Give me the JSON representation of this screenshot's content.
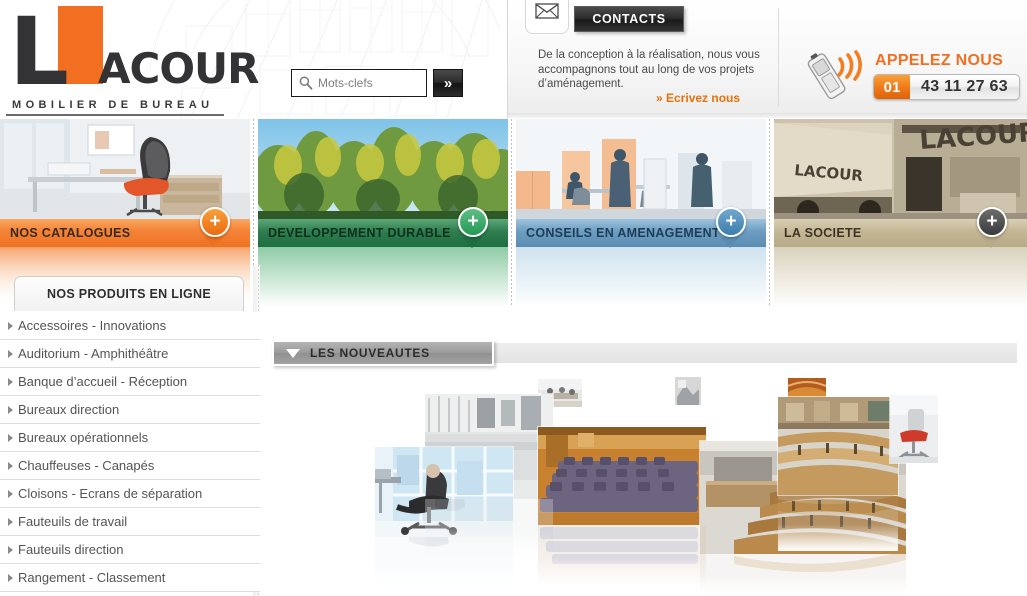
{
  "header": {
    "logo": {
      "letter": "L",
      "name": "ACOUR",
      "tagline": "MOBILIER DE BUREAU"
    },
    "search": {
      "placeholder": "Mots-clefs",
      "value": "",
      "button_label": "»",
      "icon": "search-icon"
    },
    "contacts": {
      "mail_icon": "envelope-icon",
      "button_label": "CONTACTS",
      "description": "De la conception à la réalisation, nous vous accompagnons tout au long de vos projets d’aménagement.",
      "link_label": "» Ecrivez nous"
    },
    "phone": {
      "icon": "mobile-phone-icon",
      "call_label": "APPELEZ NOUS",
      "prefix": "01",
      "number": "43 11 27 63"
    }
  },
  "banners": [
    {
      "label": "NOS CATALOGUES",
      "plus": "+",
      "accent": "#EE7120",
      "image": "office-desk-orange-chair"
    },
    {
      "label": "DEVELOPPEMENT DURABLE",
      "plus": "+",
      "accent": "#1E6E41",
      "image": "autumn-trees-sky"
    },
    {
      "label": "CONSEILS EN AMENAGEMENT",
      "plus": "+",
      "accent": "#5B8DB3",
      "image": "open-space-office-people"
    },
    {
      "label": "LA SOCIETE",
      "plus": "+",
      "accent": "#B7AA87",
      "image": "lacour-truck-warehouse-sepia"
    }
  ],
  "sidebar": {
    "tab_label": "NOS PRODUITS EN LIGNE",
    "items": [
      {
        "label": "Accessoires - Innovations"
      },
      {
        "label": "Auditorium - Amphithéâtre"
      },
      {
        "label": "Banque d’accueil - Réception"
      },
      {
        "label": "Bureaux direction"
      },
      {
        "label": "Bureaux opérationnels"
      },
      {
        "label": "Chauffeuses - Canapés"
      },
      {
        "label": "Cloisons - Ecrans de séparation"
      },
      {
        "label": "Fauteuils de travail"
      },
      {
        "label": "Fauteuils direction"
      },
      {
        "label": "Rangement - Classement"
      }
    ]
  },
  "main": {
    "nouveautes_label": "LES NOUVEAUTES",
    "nouveautes_icon": "triangle-down-icon",
    "collage": [
      {
        "name": "photo-conference-room-grey"
      },
      {
        "name": "photo-meeting-small"
      },
      {
        "name": "photo-auditorium-purple-seats"
      },
      {
        "name": "photo-lecture-hall-wood"
      },
      {
        "name": "photo-thumbnail-top"
      },
      {
        "name": "photo-executive-chair-window"
      },
      {
        "name": "photo-auditorium-orange-top"
      },
      {
        "name": "photo-curved-desks-hall"
      },
      {
        "name": "photo-red-chair-right"
      }
    ]
  },
  "colors": {
    "brand_orange": "#F26F21",
    "brand_dark": "#333335",
    "green": "#1E6E41",
    "blue": "#5B8DB3",
    "beige": "#B7AA87"
  }
}
